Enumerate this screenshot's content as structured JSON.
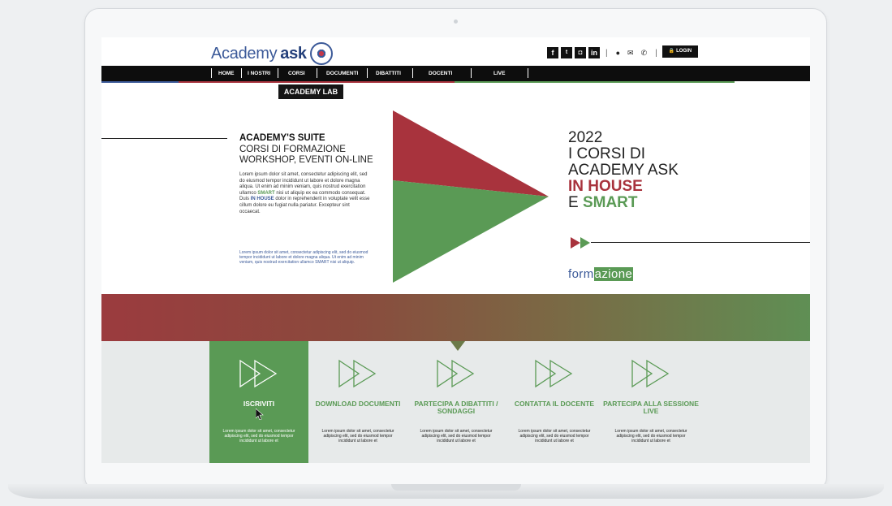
{
  "brand": {
    "name": "Academy",
    "name_bold": "ask"
  },
  "header": {
    "social": [
      "f",
      "t",
      "ig",
      "in"
    ],
    "contact_icons": [
      "location-icon",
      "mail-icon",
      "phone-icon"
    ],
    "login_label": "LOGIN"
  },
  "nav": {
    "items": [
      "HOME",
      "I NOSTRI",
      "CORSI",
      "DOCUMENTI",
      "DIBATTITI",
      "DOCENTI",
      "LIVE"
    ],
    "submenu": "ACADEMY LAB"
  },
  "hero": {
    "title": "ACADEMY'S SUITE",
    "subtitle_line1": "CORSI DI FORMAZIONE",
    "subtitle_line2": "WORKSHOP, EVENTI ON-LINE",
    "lorem_a": "Lorem ipsum dolor sit amet, consectetur adipiscing elit, sed do eiusmod tempor incididunt ut labore et dolore magna aliqua. Ut enim ad minim veniam, quis nostrud exercitation ullamco ",
    "lorem_smart": "SMART",
    "lorem_b": " nisi ut aliquip ex ea commodo consequat. Duis ",
    "lorem_inhouse": "IN HOUSE",
    "lorem_c": " dolor in reprehenderit in voluptate velit esse cillum dolore eu fugiat nulla pariatur. Excepteur sint occaecat.",
    "lorem_small": "Lorem ipsum dolor sit amet, consectetur adipiscing elit, sed do eiusmod tempor incididunt ut labore et dolore magna aliqua. Ut enim ad minim veniam, quis nostrud exercitation ullamco SMART nisi ut aliquip.",
    "year": "2022",
    "line1": "I CORSI DI",
    "line2": "ACADEMY ASK",
    "line3": "IN HOUSE",
    "line4_a": "E ",
    "line4_b": "SMART",
    "tag_a": "form",
    "tag_b": "azione"
  },
  "colors": {
    "red": "#a8333d",
    "green": "#5a9a55",
    "blue": "#3c5a99",
    "dark": "#0d0d0d"
  },
  "cards": [
    {
      "title": "ISCRIVITI",
      "text": "Lorem ipsum dolor sit amet, consectetur adipiscing elit, sed do eiusmod tempor incididunt ut labore et"
    },
    {
      "title": "DOWNLOAD DOCUMENTI",
      "text": "Lorem ipsum dolor sit amet, consectetur adipiscing elit, sed do eiusmod tempor incididunt ut labore et"
    },
    {
      "title": "PARTECIPA A DIBATTITI / SONDAGGI",
      "text": "Lorem ipsum dolor sit amet, consectetur adipiscing elit, sed do eiusmod tempor incididunt ut labore et"
    },
    {
      "title": "CONTATTA IL DOCENTE",
      "text": "Lorem ipsum dolor sit amet, consectetur adipiscing elit, sed do eiusmod tempor incididunt ut labore et"
    },
    {
      "title": "PARTECIPA ALLA SESSIONE LIVE",
      "text": "Lorem ipsum dolor sit amet, consectetur adipiscing elit, sed do eiusmod tempor incididunt ut labore et"
    }
  ]
}
